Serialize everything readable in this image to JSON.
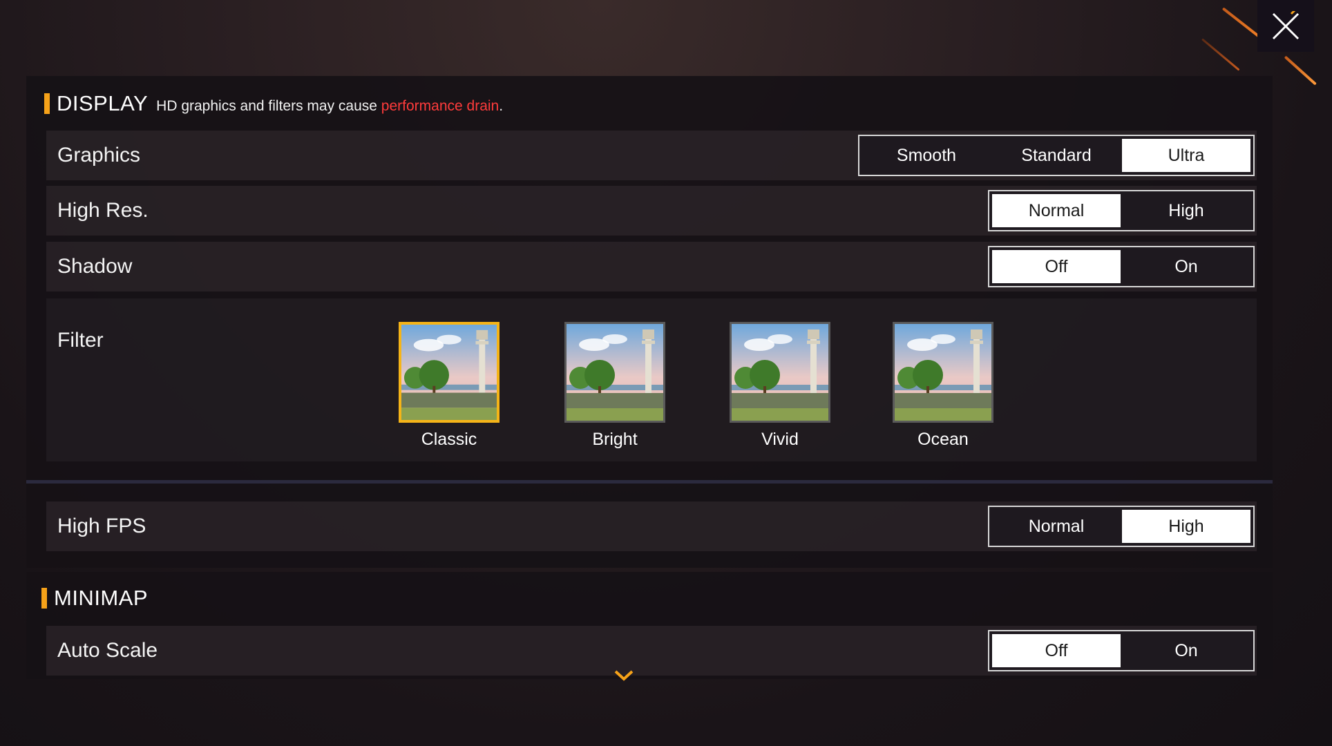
{
  "display": {
    "title": "DISPLAY",
    "note_prefix": "HD graphics and filters may cause ",
    "note_warning": "performance drain",
    "note_suffix": ".",
    "graphics": {
      "label": "Graphics",
      "options": [
        "Smooth",
        "Standard",
        "Ultra"
      ],
      "selected": "Ultra"
    },
    "high_res": {
      "label": "High Res.",
      "options": [
        "Normal",
        "High"
      ],
      "selected": "Normal"
    },
    "shadow": {
      "label": "Shadow",
      "options": [
        "Off",
        "On"
      ],
      "selected": "Off"
    },
    "filter": {
      "label": "Filter",
      "options": [
        "Classic",
        "Bright",
        "Vivid",
        "Ocean"
      ],
      "selected": "Classic"
    }
  },
  "high_fps": {
    "label": "High FPS",
    "options": [
      "Normal",
      "High"
    ],
    "selected": "High"
  },
  "minimap": {
    "title": "MINIMAP",
    "auto_scale": {
      "label": "Auto Scale",
      "options": [
        "Off",
        "On"
      ],
      "selected": "Off"
    }
  },
  "icons": {
    "close": "close-icon",
    "scroll_down": "chevron-down-icon"
  },
  "colors": {
    "accent": "#f6a219",
    "warning": "#ff3b3b",
    "selected_filter_border": "#f5b418"
  }
}
